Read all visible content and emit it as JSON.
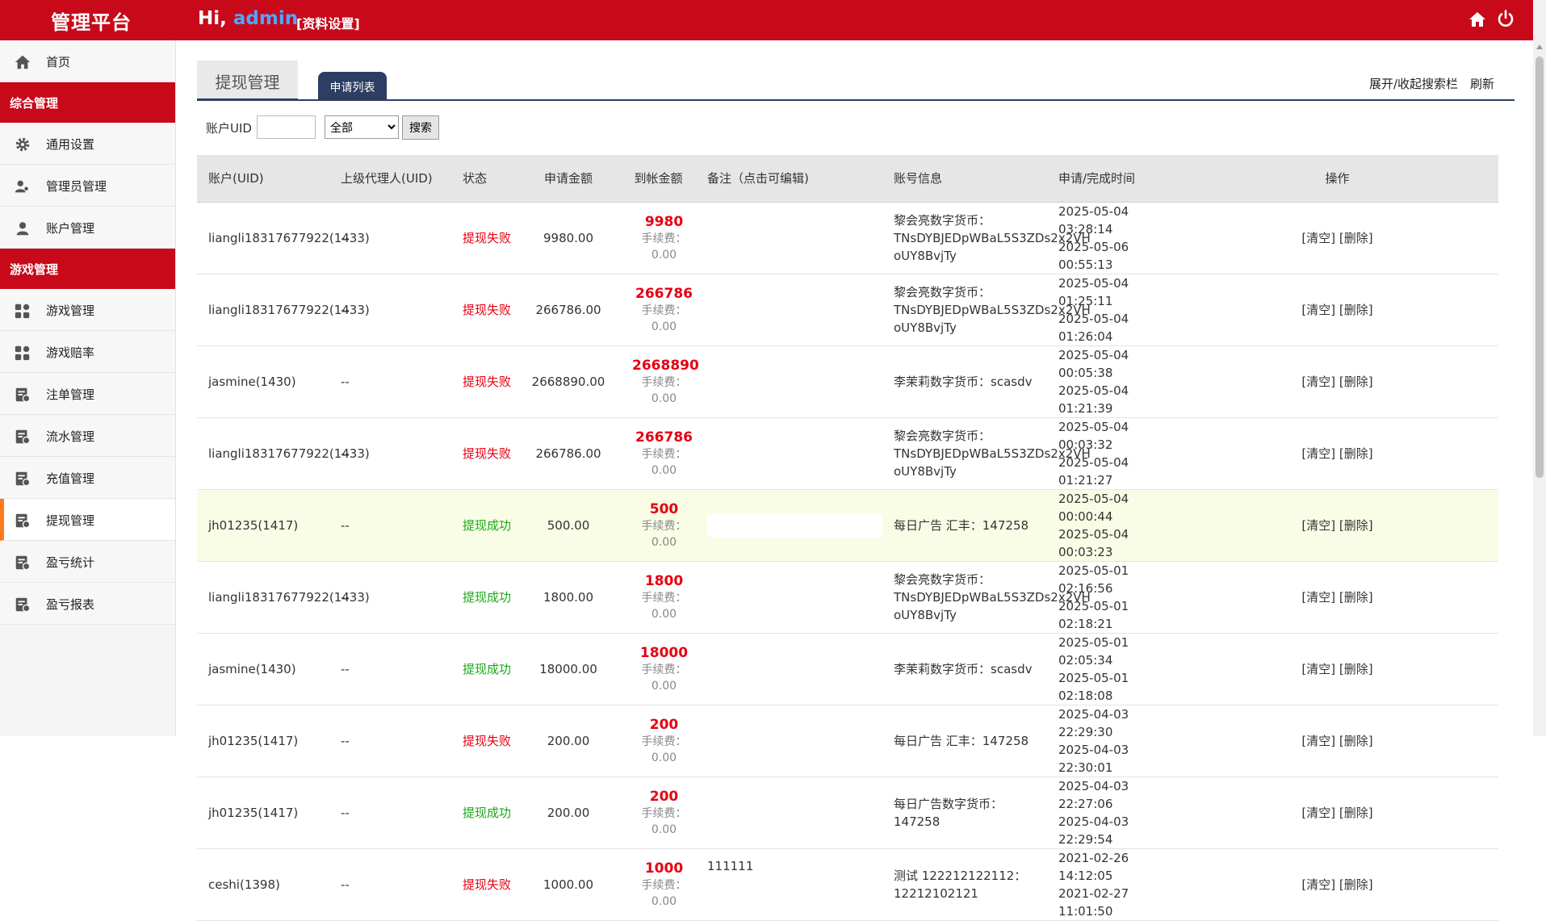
{
  "header": {
    "brand": "管理平台",
    "greeting_prefix": "Hi, ",
    "username": "admin",
    "profile_link": "[资料设置]",
    "home_icon": "home-icon",
    "power_icon": "power-icon"
  },
  "sidebar": {
    "home": {
      "label": "首页",
      "icon": "home-icon"
    },
    "group1": "综合管理",
    "group1_items": [
      {
        "label": "通用设置",
        "icon": "gear-icon"
      },
      {
        "label": "管理员管理",
        "icon": "users-icon"
      },
      {
        "label": "账户管理",
        "icon": "user-icon"
      }
    ],
    "group2": "游戏管理",
    "group2_items": [
      {
        "label": "游戏管理",
        "icon": "grid-icon"
      },
      {
        "label": "游戏赔率",
        "icon": "grid-icon"
      },
      {
        "label": "注单管理",
        "icon": "report-icon"
      },
      {
        "label": "流水管理",
        "icon": "report-icon"
      },
      {
        "label": "充值管理",
        "icon": "report-icon"
      },
      {
        "label": "提现管理",
        "icon": "report-icon",
        "active": true
      },
      {
        "label": "盈亏统计",
        "icon": "report-icon"
      },
      {
        "label": "盈亏报表",
        "icon": "report-icon"
      }
    ],
    "active_color": "#ff7a1a"
  },
  "tabs": {
    "main": "提现管理",
    "list": "申请列表"
  },
  "toolbar": {
    "toggle_search": "展开/收起搜索栏",
    "refresh": "刷新"
  },
  "search": {
    "label": "账户UID",
    "input_value": "",
    "select_value": "全部",
    "button": "搜索"
  },
  "table": {
    "headers": [
      "账户(UID)",
      "上级代理人(UID)",
      "状态",
      "申请金额",
      "到帐金额",
      "备注（点击可编辑)",
      "账号信息",
      "申请/完成时间",
      "操作"
    ],
    "fee_label": "手续费：0.00",
    "op_clear": "[清空]",
    "op_delete": "[删除]",
    "rows": [
      {
        "account": "liangli18317677922(1433)",
        "agent": "--",
        "status": "提现失败",
        "status_type": "fail",
        "apply": "9980.00",
        "received": "9980",
        "remark": "",
        "info": [
          "黎会亮数字货币：",
          "TNsDYBJEDpWBaL5S3ZDs2x2VH",
          "oUY8BvjTy"
        ],
        "time1": "2025-05-04 03:28:14",
        "time2": "2025-05-06 00:55:13"
      },
      {
        "account": "liangli18317677922(1433)",
        "agent": "--",
        "status": "提现失败",
        "status_type": "fail",
        "apply": "266786.00",
        "received": "266786",
        "remark": "",
        "info": [
          "黎会亮数字货币：",
          "TNsDYBJEDpWBaL5S3ZDs2x2VH",
          "oUY8BvjTy"
        ],
        "time1": "2025-05-04 01:25:11",
        "time2": "2025-05-04 01:26:04"
      },
      {
        "account": "jasmine(1430)",
        "agent": "--",
        "status": "提现失败",
        "status_type": "fail",
        "apply": "2668890.00",
        "received": "2668890",
        "remark": "",
        "info": [
          "李茉莉数字货币：scasdv"
        ],
        "time1": "2025-05-04 00:05:38",
        "time2": "2025-05-04 01:21:39"
      },
      {
        "account": "liangli18317677922(1433)",
        "agent": "--",
        "status": "提现失败",
        "status_type": "fail",
        "apply": "266786.00",
        "received": "266786",
        "remark": "",
        "info": [
          "黎会亮数字货币：",
          "TNsDYBJEDpWBaL5S3ZDs2x2VH",
          "oUY8BvjTy"
        ],
        "time1": "2025-05-04 00:03:32",
        "time2": "2025-05-04 01:21:27"
      },
      {
        "account": "jh01235(1417)",
        "agent": "--",
        "status": "提现成功",
        "status_type": "ok",
        "apply": "500.00",
        "received": "500",
        "remark": "",
        "info": [
          "每日广告 汇丰：147258"
        ],
        "time1": "2025-05-04 00:00:44",
        "time2": "2025-05-04 00:03:23",
        "highlight": true
      },
      {
        "account": "liangli18317677922(1433)",
        "agent": "--",
        "status": "提现成功",
        "status_type": "ok",
        "apply": "1800.00",
        "received": "1800",
        "remark": "",
        "info": [
          "黎会亮数字货币：",
          "TNsDYBJEDpWBaL5S3ZDs2x2VH",
          "oUY8BvjTy"
        ],
        "time1": "2025-05-01 02:16:56",
        "time2": "2025-05-01 02:18:21"
      },
      {
        "account": "jasmine(1430)",
        "agent": "--",
        "status": "提现成功",
        "status_type": "ok",
        "apply": "18000.00",
        "received": "18000",
        "remark": "",
        "info": [
          "李茉莉数字货币：scasdv"
        ],
        "time1": "2025-05-01 02:05:34",
        "time2": "2025-05-01 02:18:08"
      },
      {
        "account": "jh01235(1417)",
        "agent": "--",
        "status": "提现失败",
        "status_type": "fail",
        "apply": "200.00",
        "received": "200",
        "remark": "",
        "info": [
          "每日广告 汇丰：147258"
        ],
        "time1": "2025-04-03 22:29:30",
        "time2": "2025-04-03 22:30:01"
      },
      {
        "account": "jh01235(1417)",
        "agent": "--",
        "status": "提现成功",
        "status_type": "ok",
        "apply": "200.00",
        "received": "200",
        "remark": "",
        "info": [
          "每日广告数字货币：147258"
        ],
        "time1": "2025-04-03 22:27:06",
        "time2": "2025-04-03 22:29:54"
      },
      {
        "account": "ceshi(1398)",
        "agent": "--",
        "status": "提现失败",
        "status_type": "fail",
        "apply": "1000.00",
        "received": "1000",
        "remark": "111111",
        "info": [
          "测试 122212122112：",
          "12212102121"
        ],
        "time1": "2021-02-26 14:12:05",
        "time2": "2021-02-27 11:01:50"
      }
    ]
  },
  "colors": {
    "brand_red": "#c8091a",
    "tab_navy": "#2c3e62",
    "fail": "#e60012",
    "ok": "#19a919"
  }
}
